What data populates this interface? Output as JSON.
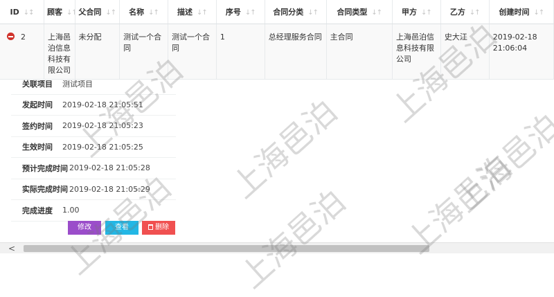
{
  "table": {
    "columns": [
      {
        "label": "ID",
        "sort": "↓↕"
      },
      {
        "label": "顾客",
        "sort": "↓↑"
      },
      {
        "label": "父合同",
        "sort": "↓↑"
      },
      {
        "label": "名称",
        "sort": "↓↑"
      },
      {
        "label": "描述",
        "sort": "↓↑"
      },
      {
        "label": "序号",
        "sort": "↓↑"
      },
      {
        "label": "合同分类",
        "sort": "↓↑"
      },
      {
        "label": "合同类型",
        "sort": "↓↑"
      },
      {
        "label": "甲方",
        "sort": "↓↑"
      },
      {
        "label": "乙方",
        "sort": "↓↑"
      },
      {
        "label": "创建时间",
        "sort": "↓↑"
      }
    ],
    "row": {
      "id": "2",
      "customer": "上海邑泊信息科技有限公司",
      "parent_contract": "未分配",
      "name": "测试一个合同",
      "description": "测试一个合同",
      "sequence": "1",
      "category": "总经理服务合同",
      "type": "主合同",
      "party_a": "上海邑泊信息科技有限公司",
      "party_b": "史大江",
      "created_at": "2019-02-18 21:06:04"
    }
  },
  "detail": {
    "project": {
      "label": "关联项目",
      "value": "测试项目"
    },
    "initiated": {
      "label": "发起时间",
      "value": "2019-02-18 21:05:51"
    },
    "signed": {
      "label": "签约时间",
      "value": "2019-02-18 21:05:23"
    },
    "effective": {
      "label": "生效时间",
      "value": "2019-02-18 21:05:25"
    },
    "planned_finish": {
      "label": "预计完成时间",
      "value": "2019-02-18 21:05:28"
    },
    "actual_finish": {
      "label": "实际完成时间",
      "value": "2019-02-18 21:05:29"
    },
    "progress": {
      "label": "完成进度",
      "value": "1.00"
    }
  },
  "actions": {
    "edit": "修改",
    "view": "查看",
    "delete": "删除"
  },
  "scrollbar": {
    "left_arrow": "<"
  },
  "watermark": "上海邑泊",
  "colors": {
    "edit": "#9b4dca",
    "view": "#23b7e5",
    "delete": "#f05050",
    "collapse": "#d0322b"
  }
}
